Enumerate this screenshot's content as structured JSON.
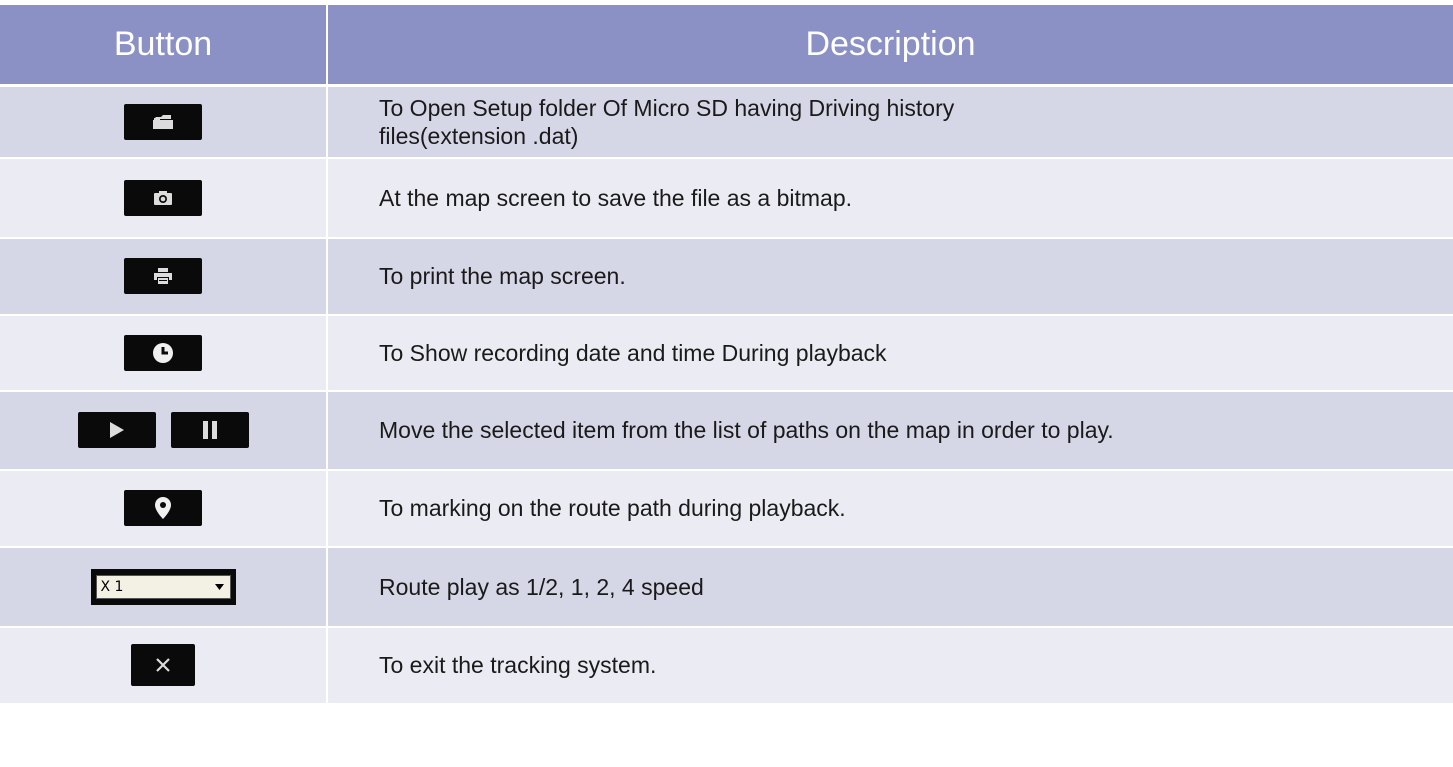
{
  "header": {
    "button_col": "Button",
    "description_col": "Description"
  },
  "rows": [
    {
      "icon": "folder-icon",
      "description_line1": "To Open Setup folder Of Micro SD having Driving history",
      "description_line2": "files(extension .dat)"
    },
    {
      "icon": "camera-icon",
      "description": "At the map screen  to save the file as a bitmap."
    },
    {
      "icon": "printer-icon",
      "description": "To print the map screen."
    },
    {
      "icon": "clock-icon",
      "description": "To Show recording date and time During playback"
    },
    {
      "icon": "play-pause-icons",
      "description": "Move the selected item from the list of paths on the map in order to play."
    },
    {
      "icon": "map-pin-icon",
      "description": "To marking on the route path during playback."
    },
    {
      "icon": "speed-dropdown",
      "dropdown_value": "X 1",
      "description": "Route play as 1/2, 1, 2, 4 speed"
    },
    {
      "icon": "close-icon",
      "description": "To exit the tracking system."
    }
  ],
  "colors": {
    "header_bg": "#8b91c5",
    "row_odd": "#d5d6e6",
    "row_even": "#ebecf3"
  }
}
